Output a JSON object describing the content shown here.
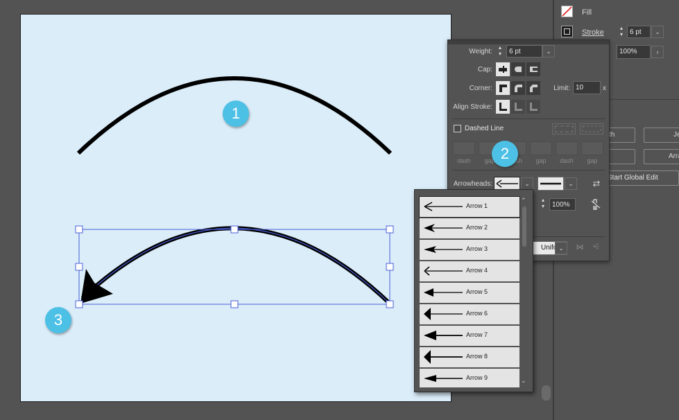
{
  "badges": {
    "one": "1",
    "two": "2",
    "three": "3"
  },
  "dock": {
    "fill_label": "Fill",
    "stroke_label": "Stroke",
    "stroke_weight": "6 pt",
    "tint_value": "100%",
    "btn_width_partial": "th",
    "btn_je_partial": "Je",
    "btn_arr_partial": "Arra",
    "start_global_edit": "Start Global Edit"
  },
  "stroke_panel": {
    "weight_label": "Weight:",
    "weight_value": "6 pt",
    "cap_label": "Cap:",
    "corner_label": "Corner:",
    "limit_label": "Limit:",
    "limit_value": "10",
    "limit_unit": "x",
    "align_label": "Align Stroke:",
    "dashed_label": "Dashed Line",
    "dash_labels": [
      "dash",
      "gap",
      "dash",
      "gap",
      "dash",
      "gap"
    ],
    "arrowheads_label": "Arrowheads:",
    "scale_value": "100%",
    "profile_value": "Uniform"
  },
  "arrow_menu": {
    "items": [
      "Arrow 1",
      "Arrow 2",
      "Arrow 3",
      "Arrow 4",
      "Arrow 5",
      "Arrow 6",
      "Arrow 7",
      "Arrow 8",
      "Arrow 9"
    ],
    "selected_index": 0
  },
  "colors": {
    "artboard": "#dbedf9",
    "badge": "#4dc0e6",
    "selection": "#4a5fd6"
  }
}
